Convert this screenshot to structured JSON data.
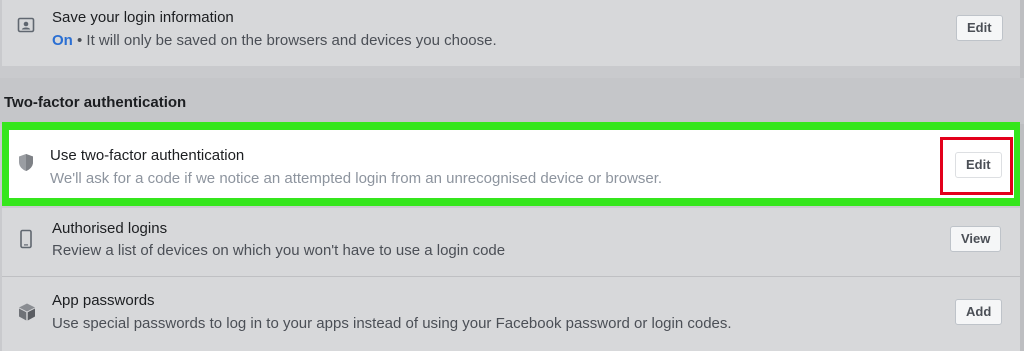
{
  "rows": {
    "save_login": {
      "title": "Save your login information",
      "status": "On",
      "desc": " • It will only be saved on the browsers and devices you choose.",
      "button": "Edit",
      "icon": "id-card-icon"
    },
    "section_title": "Two-factor authentication",
    "two_factor": {
      "title": "Use two-factor authentication",
      "desc": "We'll ask for a code if we notice an attempted login from an unrecognised device or browser.",
      "button": "Edit",
      "icon": "shield-icon"
    },
    "authorised_logins": {
      "title": "Authorised logins",
      "desc": "Review a list of devices on which you won't have to use a login code",
      "button": "View",
      "icon": "phone-icon"
    },
    "app_passwords": {
      "title": "App passwords",
      "desc": "Use special passwords to log in to your apps instead of using your Facebook password or login codes.",
      "button": "Add",
      "icon": "cube-icon"
    }
  },
  "colors": {
    "highlight_green": "#35e61c",
    "highlight_red": "#e3001b",
    "on_status": "#2a6fd3"
  }
}
